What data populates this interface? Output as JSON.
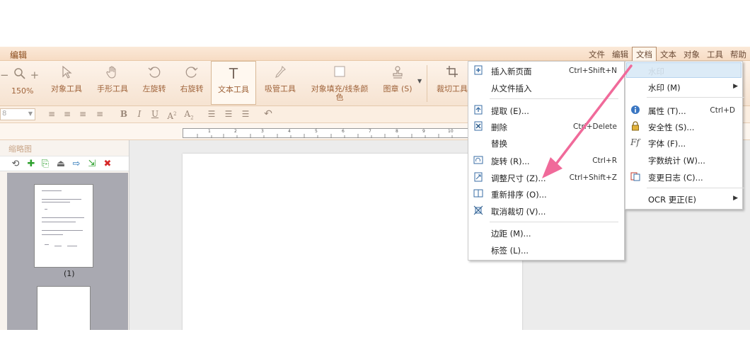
{
  "app": {
    "title": "编辑"
  },
  "menubar": [
    "文件",
    "编辑",
    "文档",
    "文本",
    "对象",
    "工具",
    "帮助"
  ],
  "ribbon": {
    "zoom_value": "150%",
    "tools": [
      {
        "label": "对象工具",
        "icon": "pointer-icon"
      },
      {
        "label": "手形工具",
        "icon": "hand-icon"
      },
      {
        "label": "左旋转",
        "icon": "rotate-left-icon"
      },
      {
        "label": "右旋转",
        "icon": "rotate-right-icon"
      },
      {
        "label": "文本工具",
        "icon": "text-tool-icon"
      },
      {
        "label": "吸管工具",
        "icon": "eyedropper-icon"
      },
      {
        "label": "对象填充/线条颜",
        "label2": "色",
        "icon": "fill-icon"
      },
      {
        "label": "图章 (S)",
        "icon": "stamp-icon"
      },
      {
        "label": "裁切工具",
        "icon": "crop-icon"
      }
    ]
  },
  "format_toolbar": {
    "font_size_value": "8"
  },
  "ruler": {
    "ticks": [
      "1",
      "2",
      "3",
      "4",
      "5",
      "6",
      "7",
      "8",
      "9",
      "10"
    ]
  },
  "left_pane": {
    "title": "缩略图",
    "page_label": "(1)"
  },
  "document_menu": {
    "items": [
      {
        "label": "插入新页面",
        "shortcut": "Ctrl+Shift+N",
        "icon": "insert-page-icon"
      },
      {
        "label": "从文件插入",
        "shortcut": "",
        "icon": ""
      },
      {
        "label": "提取 (E)...",
        "shortcut": "",
        "icon": "extract-icon"
      },
      {
        "label": "删除",
        "shortcut": "Ctrl+Delete",
        "icon": "delete-page-icon"
      },
      {
        "label": "替换",
        "shortcut": "",
        "icon": ""
      },
      {
        "label": "旋转 (R)...",
        "shortcut": "Ctrl+R",
        "icon": "rotate-page-icon"
      },
      {
        "label": "调整尺寸 (Z)...",
        "shortcut": "Ctrl+Shift+Z",
        "icon": "resize-page-icon"
      },
      {
        "label": "重新排序 (O)...",
        "shortcut": "",
        "icon": "reorder-icon"
      },
      {
        "label": "取消裁切 (V)...",
        "shortcut": "",
        "icon": "uncrop-icon"
      },
      {
        "label": "边距 (M)...",
        "shortcut": "",
        "icon": ""
      },
      {
        "label": "标签 (L)...",
        "shortcut": "",
        "icon": ""
      }
    ]
  },
  "document_submenu": {
    "highlighted": "水印",
    "items": [
      {
        "label": "水印 (M)",
        "shortcut": "",
        "icon": "",
        "has_submenu": true
      },
      {
        "label": "属性 (T)...",
        "shortcut": "Ctrl+D",
        "icon": "info-icon",
        "has_submenu": false
      },
      {
        "label": "安全性 (S)...",
        "shortcut": "",
        "icon": "lock-icon",
        "has_submenu": false
      },
      {
        "label": "字体 (F)...",
        "shortcut": "",
        "icon": "font-icon",
        "has_submenu": false
      },
      {
        "label": "字数统计 (W)...",
        "shortcut": "",
        "icon": "",
        "has_submenu": false
      },
      {
        "label": "变更日志 (C)...",
        "shortcut": "",
        "icon": "changelog-icon",
        "has_submenu": false
      },
      {
        "label": "OCR 更正(E)",
        "shortcut": "",
        "icon": "",
        "has_submenu": true
      }
    ]
  },
  "colors": {
    "accent": "#a0643b",
    "annotation_arrow": "#f06a9a",
    "highlight": "#dcebf7"
  }
}
